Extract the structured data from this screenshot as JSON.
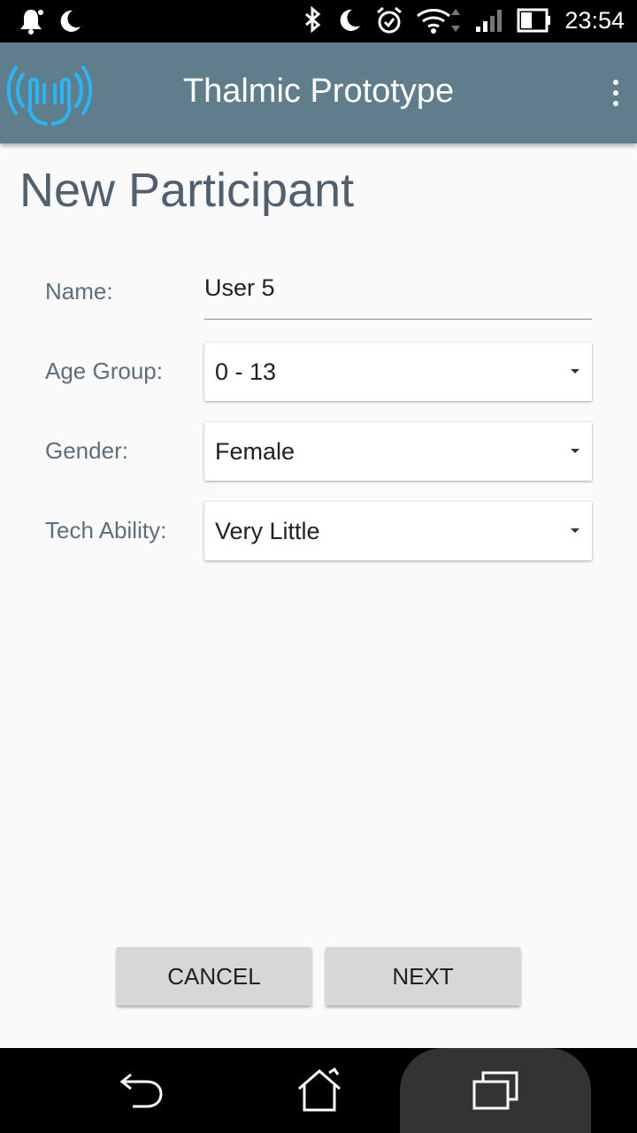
{
  "status_bar": {
    "time": "23:54",
    "icons": [
      "notification-bell-icon",
      "moon-icon",
      "bluetooth-icon",
      "moon-icon",
      "alarm-icon",
      "wifi-icon",
      "signal-icon",
      "battery-icon"
    ]
  },
  "app_bar": {
    "title": "Thalmic Prototype",
    "logo": "myo-armband-logo",
    "menu_icon": "more-vert-icon",
    "color": "#607d8b",
    "logo_color": "#29b6f6"
  },
  "page": {
    "title": "New Participant"
  },
  "form": {
    "name": {
      "label": "Name:",
      "value": "User 5"
    },
    "age_group": {
      "label": "Age Group:",
      "value": "0 - 13"
    },
    "gender": {
      "label": "Gender:",
      "value": "Female"
    },
    "tech_ability": {
      "label": "Tech Ability:",
      "value": "Very Little"
    }
  },
  "actions": {
    "cancel_label": "CANCEL",
    "next_label": "NEXT"
  },
  "nav_bar": {
    "icons": [
      "back-icon",
      "home-icon",
      "recents-icon"
    ]
  }
}
